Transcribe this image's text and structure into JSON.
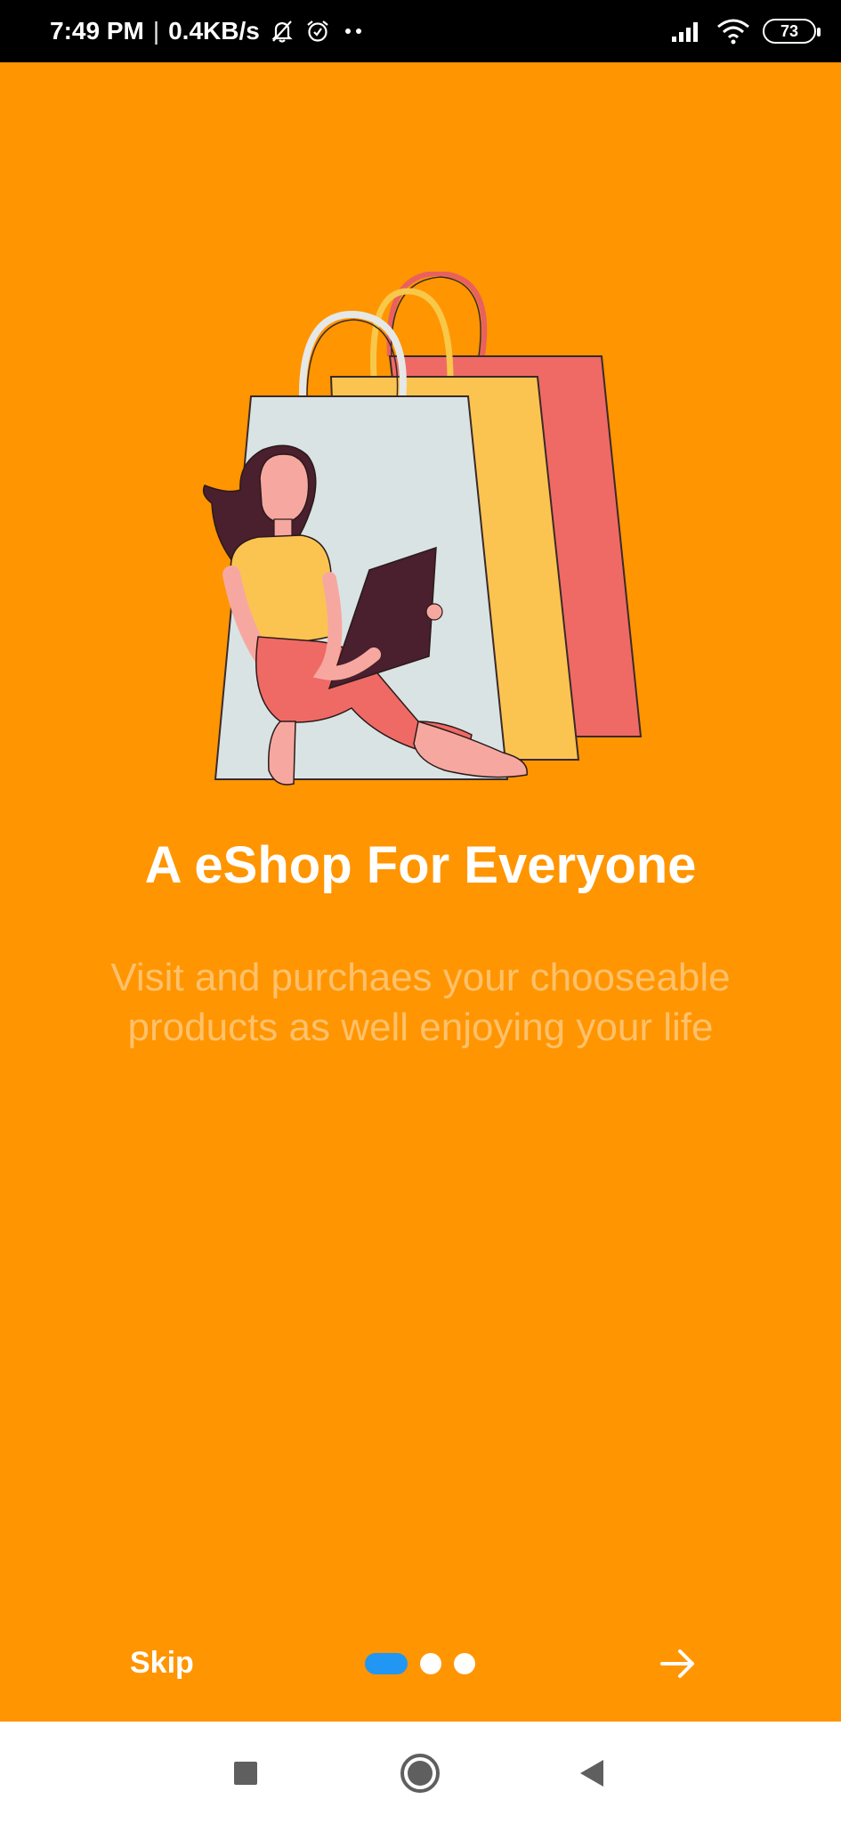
{
  "status_bar": {
    "time": "7:49 PM",
    "speed": "0.4KB/s",
    "battery": "73"
  },
  "onboarding": {
    "title": "A eShop For Everyone",
    "subtitle": "Visit and purchaes your chooseable products as well enjoying your life",
    "skip_label": "Skip"
  },
  "pager": {
    "total": 3,
    "active_index": 0
  },
  "colors": {
    "background": "#FF9500",
    "active_dot": "#2196F3",
    "subtitle": "#FFC16B"
  },
  "icons": {
    "next": "arrow-right-icon",
    "nav_square": "recent-apps-icon",
    "nav_home": "home-circle-icon",
    "nav_back": "back-triangle-icon"
  }
}
